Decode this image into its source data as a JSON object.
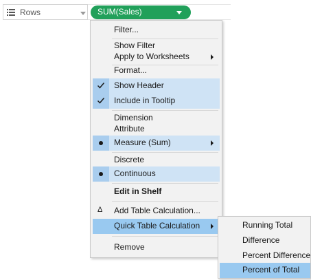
{
  "shelf": {
    "rows_label": "Rows",
    "pill_label": "SUM(Sales)",
    "pill_color": "#21a05a"
  },
  "menu": {
    "items": {
      "filter": "Filter...",
      "show_filter": "Show Filter",
      "apply_to_worksheets": "Apply to Worksheets",
      "format": "Format...",
      "show_header": "Show Header",
      "include_in_tooltip": "Include in Tooltip",
      "dimension": "Dimension",
      "attribute": "Attribute",
      "measure": "Measure (Sum)",
      "discrete": "Discrete",
      "continuous": "Continuous",
      "edit_in_shelf": "Edit in Shelf",
      "add_table_calculation": "Add Table Calculation...",
      "quick_table_calculation": "Quick Table Calculation",
      "remove": "Remove"
    },
    "checked": [
      "Show Header",
      "Include in Tooltip"
    ],
    "selected_radio": [
      "Measure (Sum)",
      "Continuous"
    ],
    "highlighted": "Quick Table Calculation",
    "icons": {
      "check": "check-icon",
      "radio": "bullet-dot-icon",
      "delta": "delta-icon",
      "submenu": "chevron-right-icon"
    },
    "colors": {
      "highlight": "#99c9f0",
      "checked_row": "#cfe3f5",
      "background": "#f2f2f2"
    }
  },
  "submenu": {
    "items": {
      "running_total": "Running Total",
      "difference": "Difference",
      "percent_difference": "Percent Difference",
      "percent_of_total": "Percent of Total"
    },
    "highlighted": "Percent of Total"
  }
}
